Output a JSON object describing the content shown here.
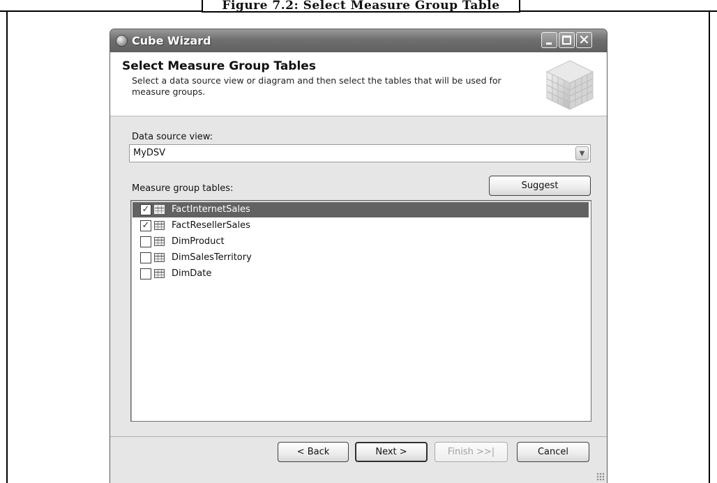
{
  "figure": {
    "caption": "Figure 7.2: Select Measure Group Table"
  },
  "window": {
    "title": "Cube Wizard",
    "controls": {
      "minimize_icon": "minimize-icon",
      "maximize_icon": "maximize-icon",
      "close_icon": "close-icon",
      "close_glyph": "✕"
    }
  },
  "header": {
    "title": "Select Measure Group Tables",
    "description": "Select a data source view or diagram and then select the tables that will be used for measure groups."
  },
  "data_source_view": {
    "label": "Data source view:",
    "value": "MyDSV",
    "arrow": "▼"
  },
  "measure_group_tables": {
    "label": "Measure group tables:",
    "suggest_label": "Suggest",
    "check_glyph": "✓",
    "items": [
      {
        "name": "FactInternetSales",
        "checked": true,
        "selected": true
      },
      {
        "name": "FactResellerSales",
        "checked": true,
        "selected": false
      },
      {
        "name": "DimProduct",
        "checked": false,
        "selected": false
      },
      {
        "name": "DimSalesTerritory",
        "checked": false,
        "selected": false
      },
      {
        "name": "DimDate",
        "checked": false,
        "selected": false
      }
    ]
  },
  "footer": {
    "back_label": "< Back",
    "next_label": "Next >",
    "finish_label": "Finish >>|",
    "cancel_label": "Cancel",
    "finish_enabled": false
  },
  "colors": {
    "titlebar": "#6f6f6f",
    "selection": "#626262",
    "window_bg": "#e6e6e6"
  }
}
